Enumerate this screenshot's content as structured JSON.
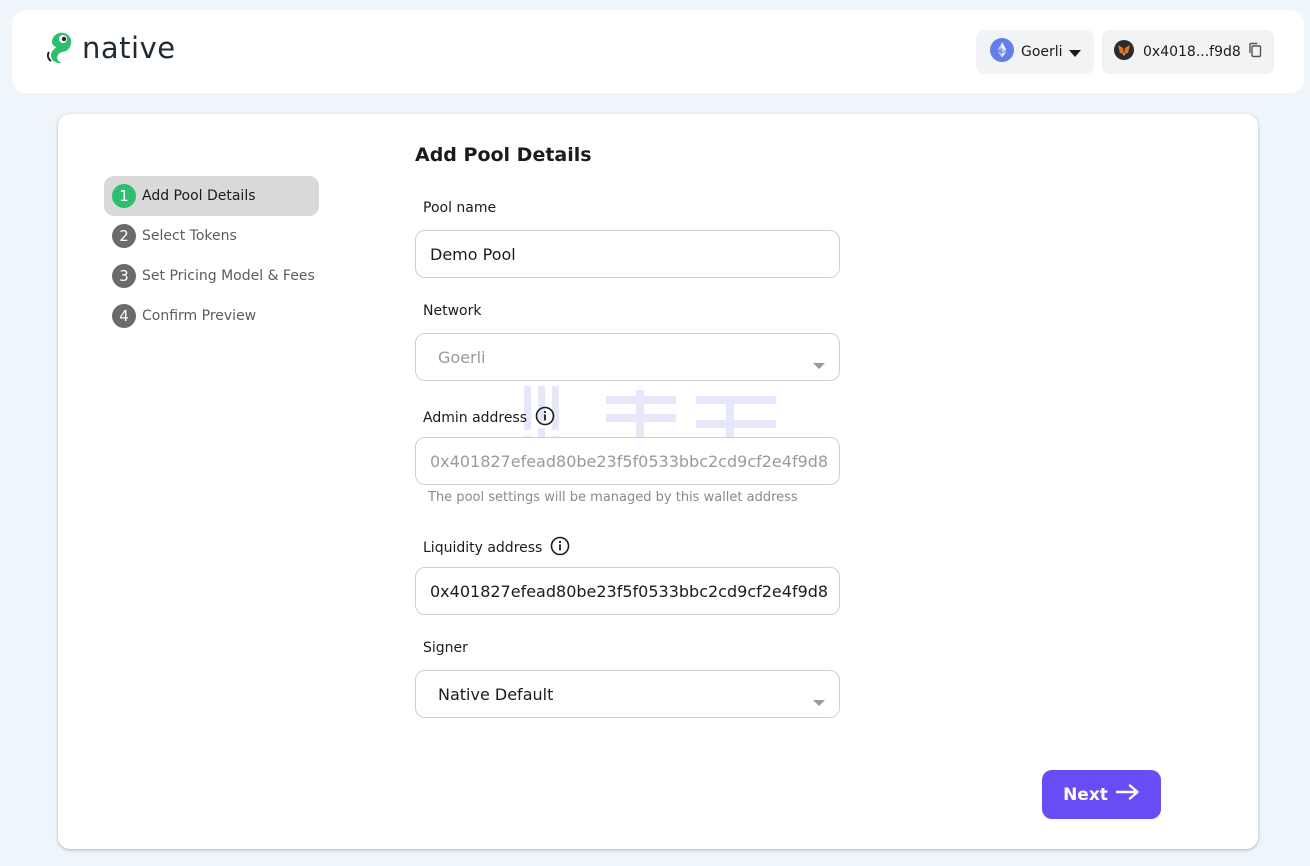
{
  "header": {
    "logo_text": "native",
    "network": {
      "label": "Goerli",
      "icon": "ethereum-icon"
    },
    "wallet": {
      "label": "0x4018...f9d8",
      "icon": "metamask-fox-icon"
    }
  },
  "steps": [
    {
      "number": "1",
      "label": "Add Pool Details",
      "active": true
    },
    {
      "number": "2",
      "label": "Select Tokens",
      "active": false
    },
    {
      "number": "3",
      "label": "Set Pricing Model & Fees",
      "active": false
    },
    {
      "number": "4",
      "label": "Confirm Preview",
      "active": false
    }
  ],
  "form": {
    "title": "Add Pool Details",
    "pool_name": {
      "label": "Pool name",
      "value": "Demo Pool"
    },
    "network": {
      "label": "Network",
      "value": "Goerli"
    },
    "admin_address": {
      "label": "Admin address",
      "placeholder": "0x401827efead80be23f5f0533bbc2cd9cf2e4f9d8",
      "helper": "The pool settings will be managed by this wallet address"
    },
    "liquidity_address": {
      "label": "Liquidity address",
      "value": "0x401827efead80be23f5f0533bbc2cd9cf2e4f9d8"
    },
    "signer": {
      "label": "Signer",
      "value": "Native Default"
    }
  },
  "actions": {
    "next_label": "Next"
  },
  "colors": {
    "accent": "#6a4cf5",
    "active_step": "#2dbf70",
    "background": "#eef6fb"
  }
}
